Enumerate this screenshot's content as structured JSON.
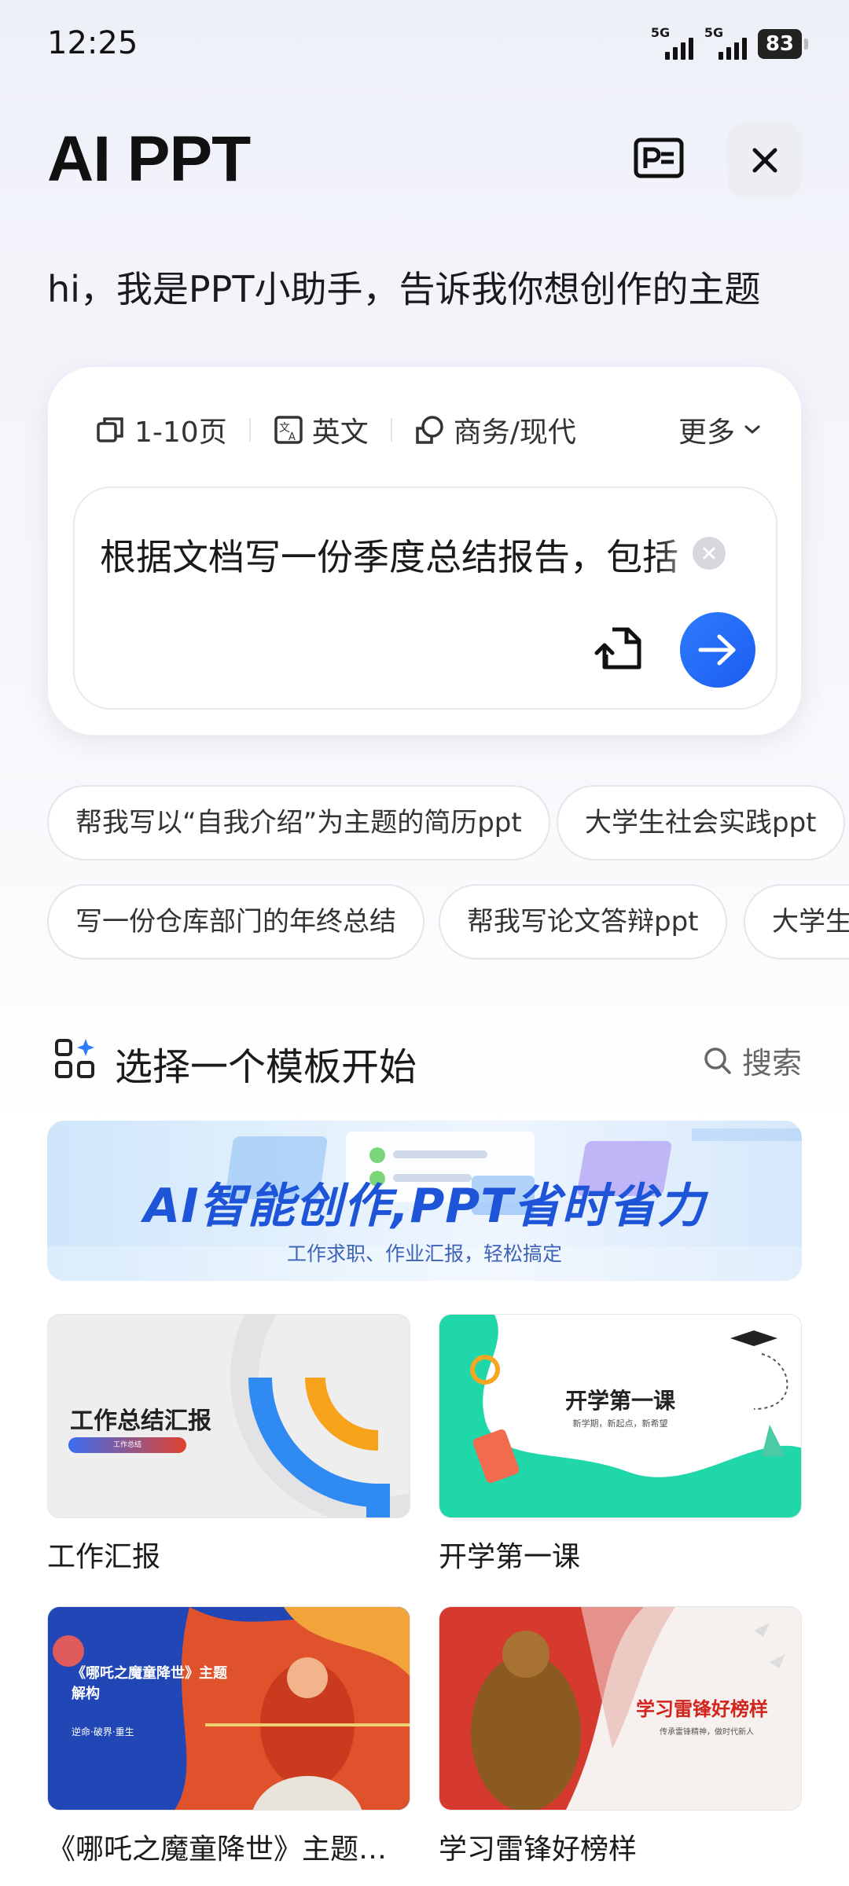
{
  "status_bar": {
    "time": "12:25",
    "signal_1": "5G",
    "signal_2": "5G",
    "battery": "83"
  },
  "header": {
    "title": "AI PPT",
    "slides_icon": "slides-icon",
    "close_icon": "close-icon"
  },
  "greeting": "hi，我是PPT小助手，告诉我你想创作的主题",
  "options": {
    "pages": "1-10页",
    "language": "英文",
    "style": "商务/现代",
    "more": "更多"
  },
  "input": {
    "value": "根据文档写一份季度总结报告，包括"
  },
  "suggestions": [
    "帮我写以“自我介绍”为主题的简历ppt",
    "大学生社会实践ppt",
    "写一份仓库部门的年终总结",
    "帮我写论文答辩ppt",
    "大学生"
  ],
  "templates_section": {
    "title": "选择一个模板开始",
    "search": "搜索"
  },
  "banner": {
    "title": "AI智能创作,PPT省时省力",
    "subtitle": "工作求职、作业汇报，轻松搞定"
  },
  "templates": [
    {
      "label": "工作汇报",
      "thumb_title": "工作总结汇报",
      "thumb_tag": "工作总结"
    },
    {
      "label": "开学第一课",
      "thumb_title": "开学第一课",
      "thumb_sub": "新学期，新起点，新希望"
    },
    {
      "label": "《哪吒之魔童降世》主题…",
      "thumb_title": "《哪吒之魔童降世》主题解构",
      "thumb_sub": "逆命·破界·重生"
    },
    {
      "label": "学习雷锋好榜样",
      "thumb_title": "学习雷锋好榜样",
      "thumb_sub": "传承雷锋精神，做时代新人"
    }
  ],
  "colors": {
    "accent": "#1b5df0",
    "banner_text": "#1e55d8"
  }
}
